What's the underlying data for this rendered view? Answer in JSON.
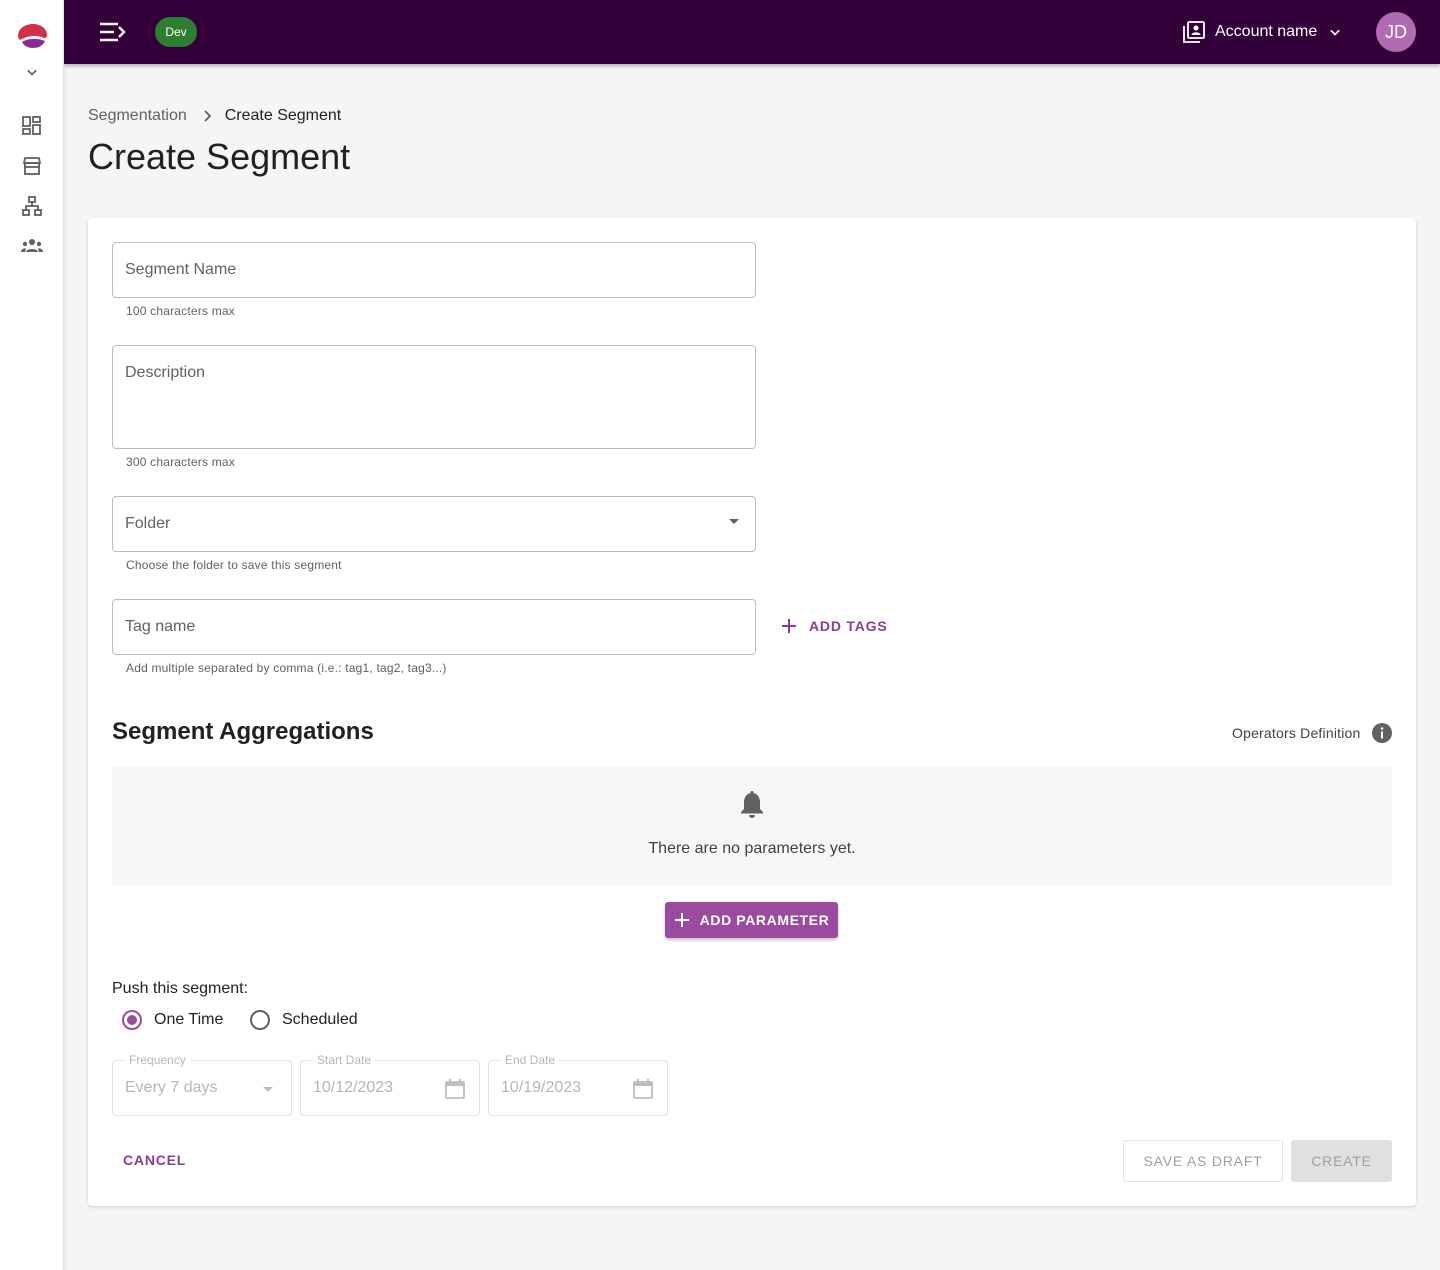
{
  "topbar": {
    "env_badge": "Dev",
    "account_name": "Account name",
    "avatar_initials": "JD",
    "bg_color": "#33003a"
  },
  "sidebar": {
    "items": [
      {
        "icon": "dashboard-icon"
      },
      {
        "icon": "store-icon"
      },
      {
        "icon": "hierarchy-icon"
      },
      {
        "icon": "groups-icon"
      }
    ]
  },
  "breadcrumb": {
    "parent": "Segmentation",
    "current": "Create Segment"
  },
  "page_title": "Create Segment",
  "form": {
    "segment_name": {
      "placeholder": "Segment Name",
      "value": "",
      "helper": "100 characters max"
    },
    "description": {
      "placeholder": "Description",
      "value": "",
      "helper": "300 characters max"
    },
    "folder": {
      "placeholder": "Folder",
      "value": "",
      "helper": "Choose the folder to save this segment"
    },
    "tag_name": {
      "placeholder": "Tag name",
      "value": "",
      "helper": "Add multiple separated by comma (i.e.: tag1, tag2, tag3...)"
    },
    "add_tags_label": "ADD TAGS"
  },
  "aggregations": {
    "title": "Segment Aggregations",
    "operators_definition": "Operators Definition",
    "empty_text": "There are no parameters yet.",
    "add_parameter_label": "ADD PARAMETER"
  },
  "push": {
    "label": "Push this segment:",
    "options": [
      {
        "label": "One Time",
        "selected": true
      },
      {
        "label": "Scheduled",
        "selected": false
      }
    ],
    "frequency": {
      "label": "Frequency",
      "value": "Every 7 days"
    },
    "start_date": {
      "label": "Start Date",
      "value": "10/12/2023"
    },
    "end_date": {
      "label": "End Date",
      "value": "10/19/2023"
    }
  },
  "actions": {
    "cancel": "CANCEL",
    "save_draft": "SAVE AS DRAFT",
    "create": "CREATE"
  },
  "colors": {
    "accent": "#9c4aa0",
    "accent_text": "#8e3a94",
    "env_badge": "#2e7d32",
    "avatar": "#b06bb3"
  }
}
